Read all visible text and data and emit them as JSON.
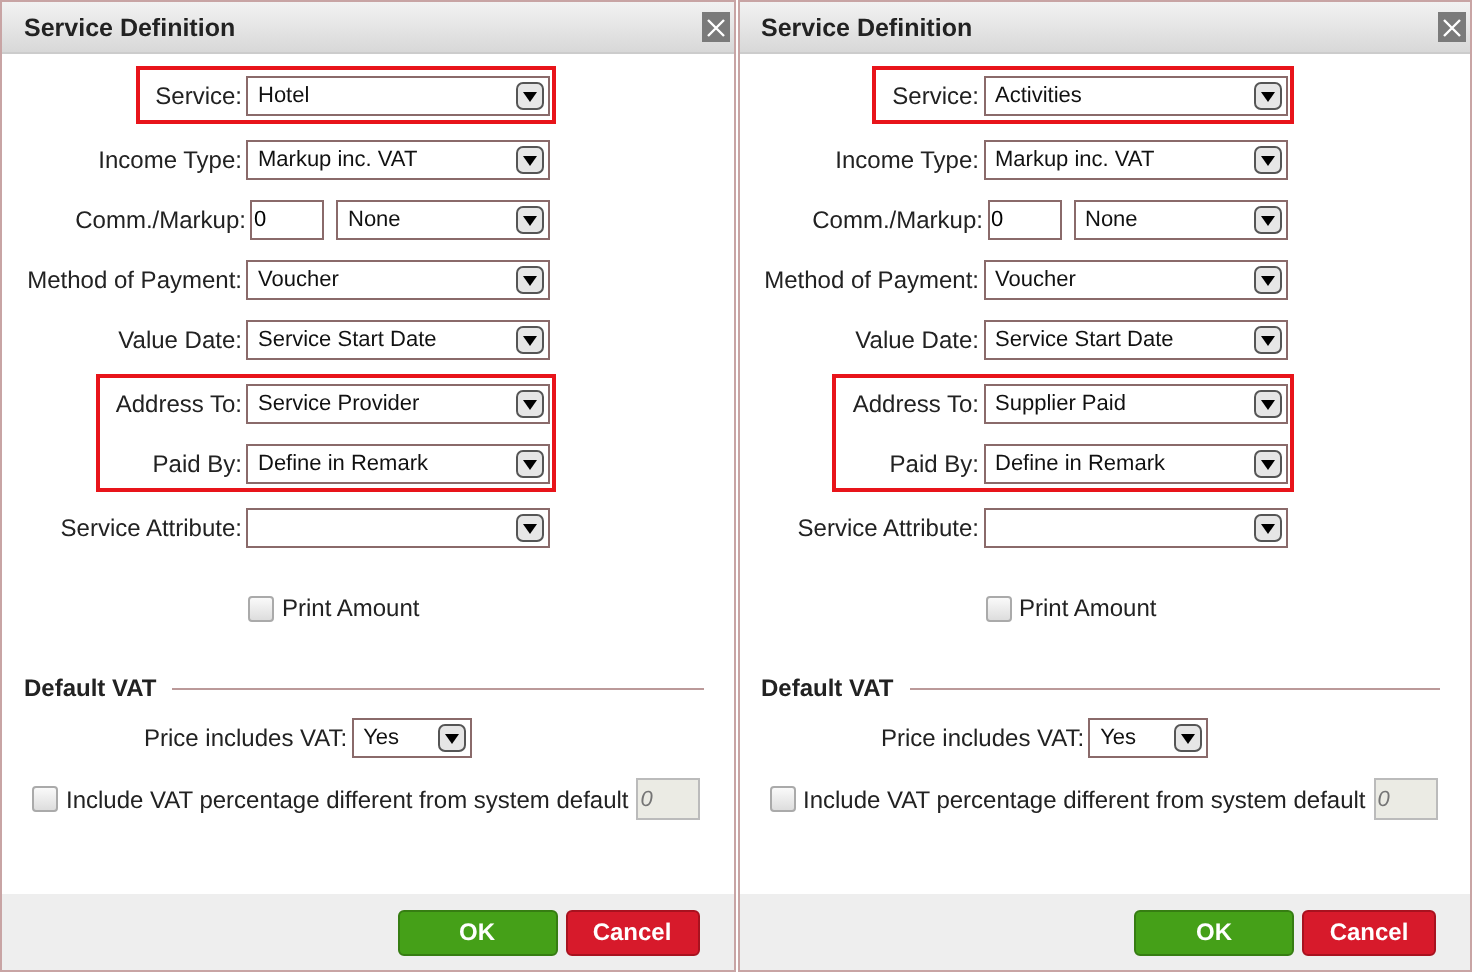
{
  "dialogs": [
    {
      "title": "Service Definition",
      "groups": [
        {
          "highlighted": true,
          "fields": [
            {
              "kind": "select",
              "label": "Service:",
              "value": "Hotel"
            }
          ]
        },
        {
          "highlighted": false,
          "fields": [
            {
              "kind": "select",
              "label": "Income Type:",
              "value": "Markup inc. VAT"
            },
            {
              "kind": "combo",
              "label": "Comm./Markup:",
              "value": "0",
              "option": "None"
            },
            {
              "kind": "select",
              "label": "Method of Payment:",
              "value": "Voucher"
            },
            {
              "kind": "select",
              "label": "Value Date:",
              "value": "Service Start Date"
            }
          ]
        },
        {
          "highlighted": true,
          "fields": [
            {
              "kind": "select",
              "label": "Address To:",
              "value": "Service Provider"
            },
            {
              "kind": "select",
              "label": "Paid By:",
              "value": "Define in Remark"
            }
          ]
        },
        {
          "highlighted": false,
          "fields": [
            {
              "kind": "select",
              "label": "Service Attribute:"
            }
          ]
        }
      ],
      "print_amount": {
        "label": "Print Amount",
        "checked": false
      },
      "vat": {
        "heading": "Default VAT",
        "price_label": "Price includes VAT:",
        "price_value": "Yes",
        "custom": {
          "label": "Include VAT percentage different from system default",
          "checked": false,
          "placeholder": "0",
          "disabled": true
        }
      },
      "buttons": [
        {
          "kind": "ok",
          "label": "OK"
        },
        {
          "kind": "cancel",
          "label": "Cancel"
        }
      ]
    },
    {
      "title": "Service Definition",
      "groups": [
        {
          "highlighted": true,
          "fields": [
            {
              "kind": "select",
              "label": "Service:",
              "value": "Activities"
            }
          ]
        },
        {
          "highlighted": false,
          "fields": [
            {
              "kind": "select",
              "label": "Income Type:",
              "value": "Markup inc. VAT"
            },
            {
              "kind": "combo",
              "label": "Comm./Markup:",
              "value": "0",
              "option": "None"
            },
            {
              "kind": "select",
              "label": "Method of Payment:",
              "value": "Voucher"
            },
            {
              "kind": "select",
              "label": "Value Date:",
              "value": "Service Start Date"
            }
          ]
        },
        {
          "highlighted": true,
          "fields": [
            {
              "kind": "select",
              "label": "Address To:",
              "value": "Supplier Paid"
            },
            {
              "kind": "select",
              "label": "Paid By:",
              "value": "Define in Remark"
            }
          ]
        },
        {
          "highlighted": false,
          "fields": [
            {
              "kind": "select",
              "label": "Service Attribute:"
            }
          ]
        }
      ],
      "print_amount": {
        "label": "Print Amount",
        "checked": false
      },
      "vat": {
        "heading": "Default VAT",
        "price_label": "Price includes VAT:",
        "price_value": "Yes",
        "custom": {
          "label": "Include VAT percentage different from system default",
          "checked": false,
          "placeholder": "0",
          "disabled": true
        }
      },
      "buttons": [
        {
          "kind": "ok",
          "label": "OK"
        },
        {
          "kind": "cancel",
          "label": "Cancel"
        }
      ]
    }
  ]
}
